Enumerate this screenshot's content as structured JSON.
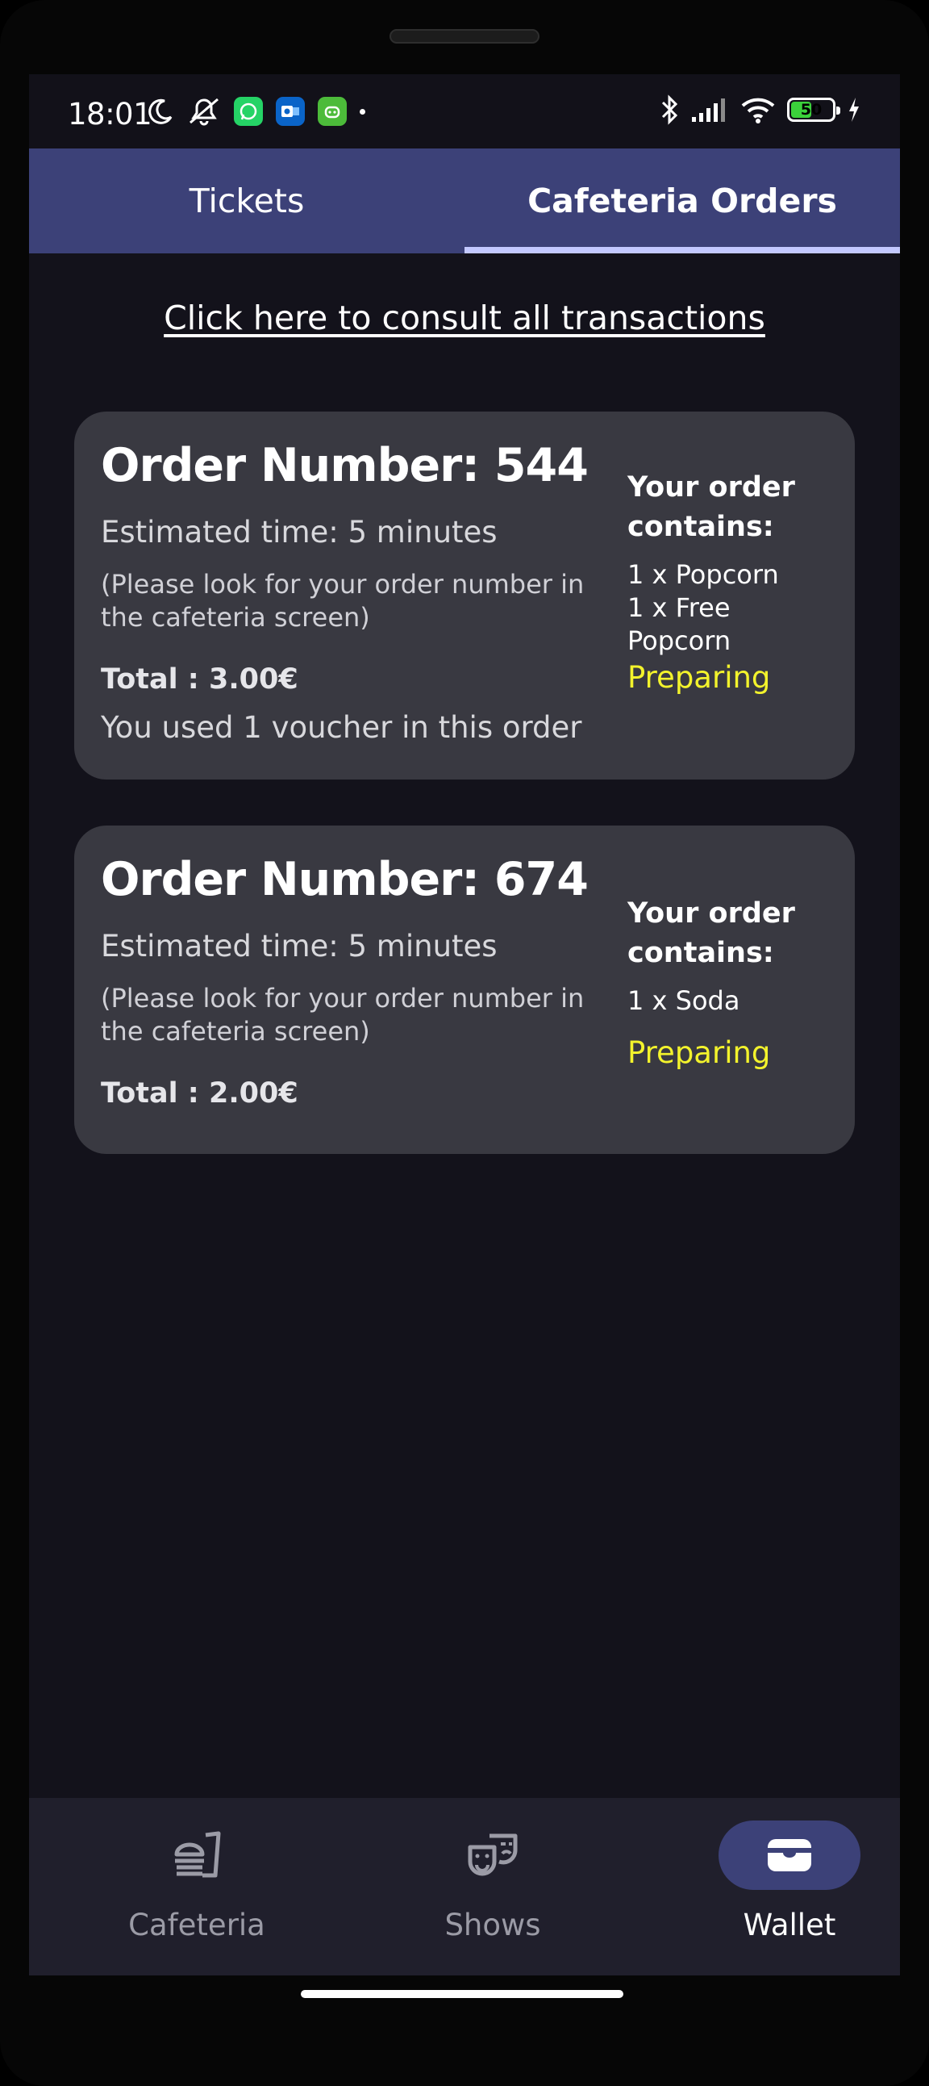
{
  "status_bar": {
    "time": "18:01",
    "battery": "50",
    "left_icons": [
      "moon-icon",
      "mute-icon",
      "whatsapp-icon",
      "outlook-icon",
      "android-icon",
      "dot-icon"
    ],
    "right_icons": [
      "bluetooth-icon",
      "signal-icon",
      "wifi-icon",
      "battery-icon",
      "charging-icon"
    ],
    "colors": {
      "whatsapp": "#25d366",
      "outlook": "#0a64c8",
      "android": "#4cbb3a",
      "battery_fill": "#3bd23b"
    }
  },
  "tabs": [
    {
      "label": "Tickets",
      "selected": false
    },
    {
      "label": "Cafeteria Orders",
      "selected": true
    }
  ],
  "consult_link": "Click here to consult all transactions",
  "orders": [
    {
      "title": "Order Number: 544",
      "estimated": "Estimated time: 5 minutes",
      "note": "(Please look for your order number in the cafeteria screen)",
      "total": "Total : 3.00€",
      "voucher": "You used 1 voucher in this order",
      "contains_title": "Your order contains:",
      "items": [
        "1 x Popcorn",
        "1 x Free",
        "Popcorn"
      ],
      "status": "Preparing"
    },
    {
      "title": "Order Number: 674",
      "estimated": "Estimated time: 5 minutes",
      "note": "(Please look for your order number in the cafeteria screen)",
      "total": "Total : 2.00€",
      "contains_title": "Your order contains:",
      "items": [
        "1 x Soda"
      ],
      "status": "Preparing"
    }
  ],
  "bottom_nav": [
    {
      "label": "Cafeteria",
      "icon": "cafeteria-icon",
      "selected": false
    },
    {
      "label": "Shows",
      "icon": "theater-masks-icon",
      "selected": false
    },
    {
      "label": "Wallet",
      "icon": "wallet-icon",
      "selected": true
    }
  ],
  "colors": {
    "background": "#13121b",
    "tab_bar": "#3c4178",
    "tab_indicator": "#c3c8ff",
    "card": "#393941",
    "status_preparing": "#f3f32c",
    "nav_bar": "#201f2c",
    "nav_active_pill": "#3c4178"
  }
}
